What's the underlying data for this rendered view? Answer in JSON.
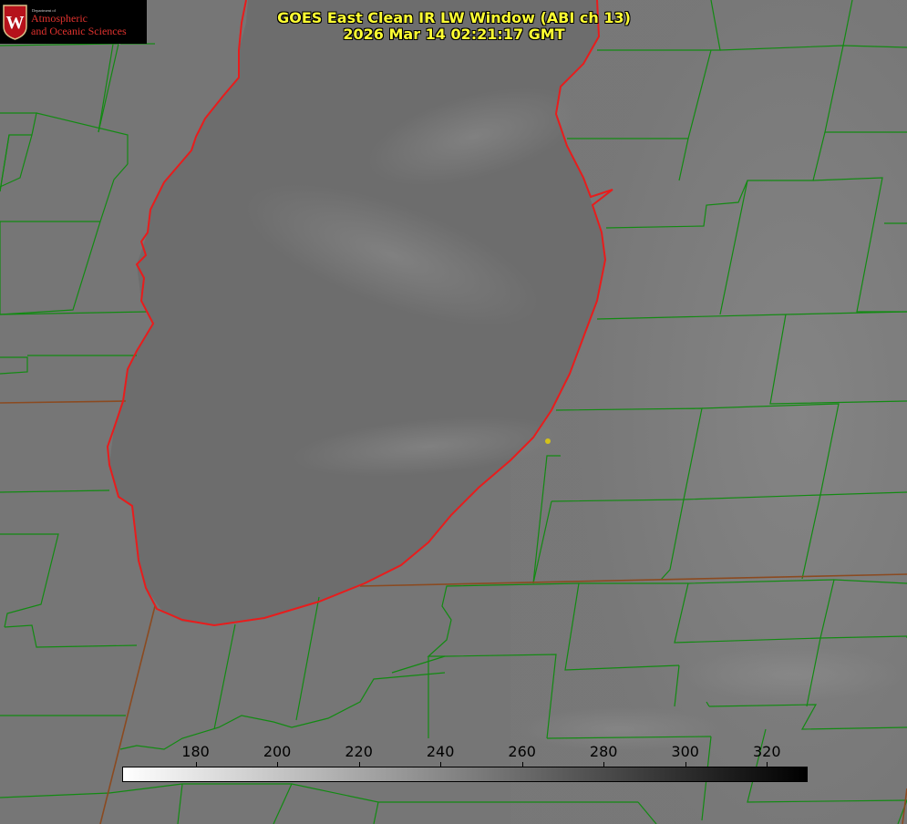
{
  "title": {
    "line1": "GOES East Clean IR LW Window (ABI ch 13)",
    "line2": "2026 Mar 14 02:21:17 GMT"
  },
  "logo": {
    "department": "Department of",
    "line1": "Atmospheric",
    "line2": "and Oceanic Sciences",
    "seal_letter": "W"
  },
  "colorbar": {
    "ticks": [
      "180",
      "200",
      "220",
      "240",
      "260",
      "280",
      "300",
      "320"
    ],
    "range": [
      162,
      330
    ],
    "scale": "white-to-black (cold to warm brightness temperature)"
  },
  "colors": {
    "county_lines": "#128a12",
    "state_lines": "#8b4a20",
    "lake_outline": "#e81c1c",
    "title_text": "#ffff33",
    "marker": "#d4c21a",
    "logo_red": "#e0322e"
  },
  "map": {
    "features": [
      "lake-michigan-outline",
      "county-boundaries",
      "state-boundaries",
      "location-marker"
    ]
  }
}
